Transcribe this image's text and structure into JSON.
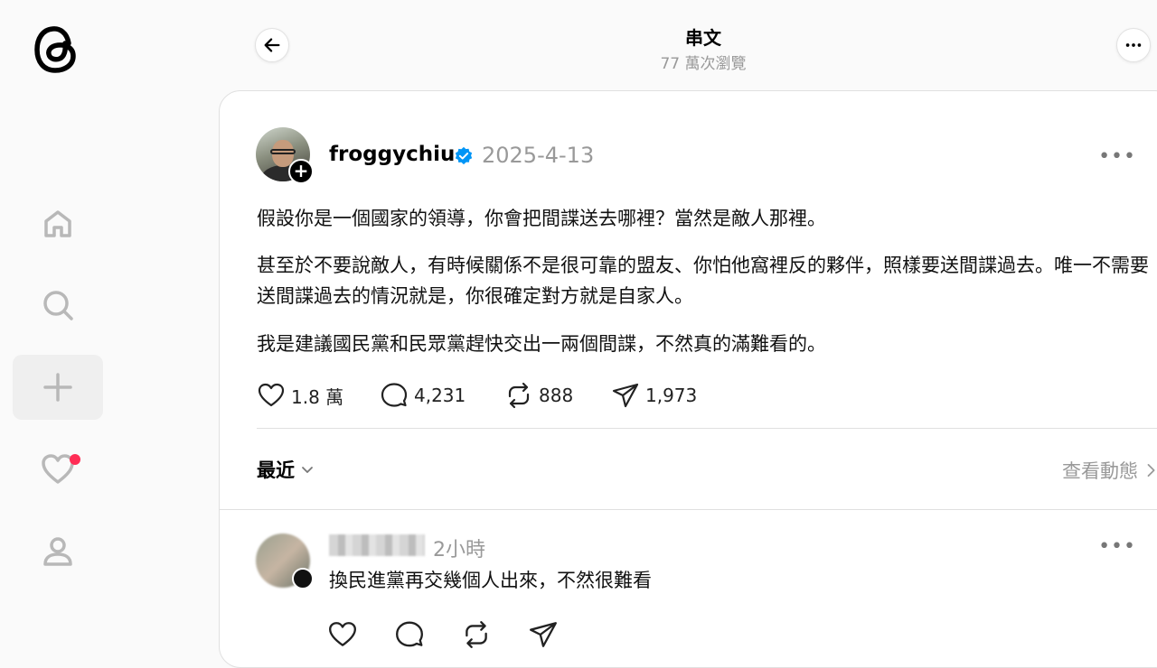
{
  "sidebar": {
    "logo_icon": "threads-logo-icon",
    "items": [
      {
        "name": "home",
        "icon": "home-icon"
      },
      {
        "name": "search",
        "icon": "search-icon"
      },
      {
        "name": "create",
        "icon": "plus-icon"
      },
      {
        "name": "activity",
        "icon": "heart-icon"
      },
      {
        "name": "profile",
        "icon": "user-icon"
      }
    ]
  },
  "header": {
    "title": "串文",
    "views": "77 萬次瀏覽"
  },
  "post": {
    "username": "froggychiu",
    "date": "2025-4-13",
    "paragraphs": [
      "假設你是一個國家的領導，你會把間諜送去哪裡？當然是敵人那裡。",
      "甚至於不要說敵人，有時候關係不是很可靠的盟友、你怕他窩裡反的夥伴，照樣要送間諜過去。唯一不需要送間諜過去的情況就是，你很確定對方就是自家人。",
      "我是建議國民黨和民眾黨趕快交出一兩個間諜，不然真的滿難看的。"
    ],
    "likes": "1.8 萬",
    "replies": "4,231",
    "reposts": "888",
    "shares": "1,973"
  },
  "replies_bar": {
    "sort_label": "最近",
    "activity_label": "查看動態"
  },
  "comment": {
    "time": "2小時",
    "text": "換民進黨再交幾個人出來，不然很難看"
  },
  "colors": {
    "accent_verified": "#0095f6",
    "notification_dot": "#ff2d55"
  }
}
